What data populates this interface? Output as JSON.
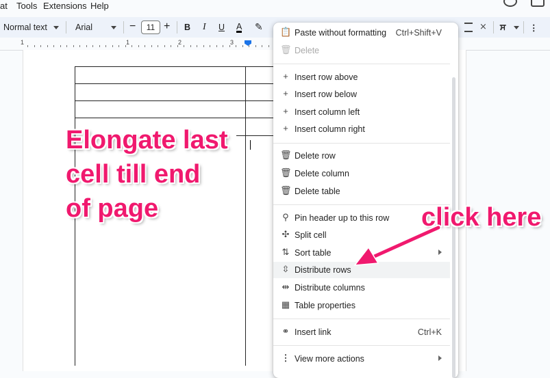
{
  "menubar": {
    "items": [
      "at",
      "Tools",
      "Extensions",
      "Help"
    ]
  },
  "toolbar": {
    "style": "Normal text",
    "font": "Arial",
    "minus": "−",
    "font_size": "11",
    "plus": "+",
    "bold": "B",
    "italic": "I",
    "underline": "U",
    "text_color": "A",
    "more": "⋮",
    "lang": "ਸ"
  },
  "ruler": {
    "numbers": [
      "1",
      "1",
      "2",
      "3"
    ]
  },
  "context_menu": {
    "items": [
      {
        "icon": "paste-icon",
        "label": "Paste without formatting",
        "shortcut": "Ctrl+Shift+V"
      },
      {
        "icon": "trash-icon",
        "label": "Delete",
        "disabled": true
      },
      {
        "icon": "plus-icon",
        "label": "Insert row above"
      },
      {
        "icon": "plus-icon",
        "label": "Insert row below"
      },
      {
        "icon": "plus-icon",
        "label": "Insert column left"
      },
      {
        "icon": "plus-icon",
        "label": "Insert column right"
      },
      {
        "icon": "trash-icon",
        "label": "Delete row"
      },
      {
        "icon": "trash-icon",
        "label": "Delete column"
      },
      {
        "icon": "trash-icon",
        "label": "Delete table"
      },
      {
        "icon": "pin-icon",
        "label": "Pin header up to this row"
      },
      {
        "icon": "split-cell-icon",
        "label": "Split cell"
      },
      {
        "icon": "sort-icon",
        "label": "Sort table"
      },
      {
        "icon": "distribute-rows-icon",
        "label": "Distribute rows"
      },
      {
        "icon": "distribute-columns-icon",
        "label": "Distribute columns"
      },
      {
        "icon": "table-properties-icon",
        "label": "Table properties"
      },
      {
        "icon": "link-icon",
        "label": "Insert link",
        "shortcut": "Ctrl+K"
      },
      {
        "icon": "more-vert-icon",
        "label": "View more actions"
      }
    ]
  },
  "annotations": {
    "left": [
      "Elongate last",
      "cell till end",
      "of page"
    ],
    "right": "click here",
    "color": "#f0196e"
  }
}
